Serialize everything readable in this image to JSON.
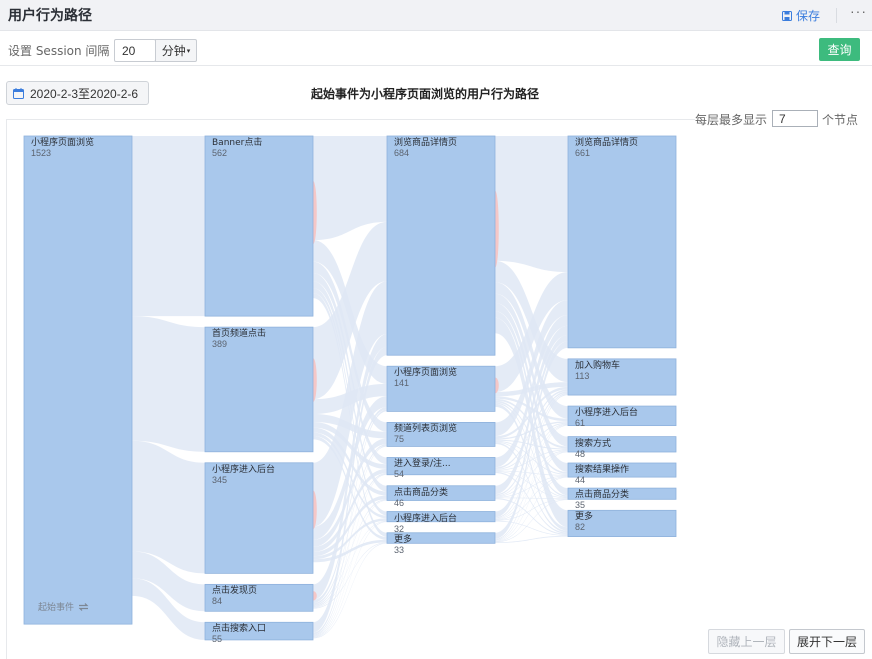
{
  "header": {
    "title": "用户行为路径",
    "save_label": "保存",
    "more_label": "···"
  },
  "settings": {
    "session_label": "设置 Session 间隔",
    "session_value": "20",
    "unit_label": "分钟",
    "query_label": "查询"
  },
  "date_range": "2020-2-3至2020-2-6",
  "chart_title": "起始事件为小程序页面浏览的用户行为路径",
  "max_nodes": {
    "prefix": "每层最多显示",
    "value": "7",
    "suffix": "个节点"
  },
  "start_tag": "起始事件",
  "buttons": {
    "prev_layer": "隐藏上一层",
    "next_layer": "展开下一层"
  },
  "colors": {
    "node": "#a9c8ec",
    "node_border": "#8fb2dc",
    "link": "#dfe8f5",
    "dropout": "#f5c7c7",
    "accent": "#3dbb7e",
    "link_text": "#3b7ddd"
  },
  "chart_data": {
    "type": "sankey",
    "layers": [
      [
        {
          "name": "小程序页面浏览",
          "value": 1523
        }
      ],
      [
        {
          "name": "Banner点击",
          "value": 562
        },
        {
          "name": "首页频道点击",
          "value": 389
        },
        {
          "name": "小程序进入后台",
          "value": 345
        },
        {
          "name": "点击发现页",
          "value": 84
        },
        {
          "name": "点击搜索入口",
          "value": 55
        }
      ],
      [
        {
          "name": "浏览商品详情页",
          "value": 684
        },
        {
          "name": "小程序页面浏览",
          "value": 141
        },
        {
          "name": "频道列表页浏览",
          "value": 75
        },
        {
          "name": "进入登录/注...",
          "value": 54
        },
        {
          "name": "点击商品分类",
          "value": 46
        },
        {
          "name": "小程序进入后台",
          "value": 32
        },
        {
          "name": "更多",
          "value": 33
        }
      ],
      [
        {
          "name": "浏览商品详情页",
          "value": 661
        },
        {
          "name": "加入购物车",
          "value": 113
        },
        {
          "name": "小程序进入后台",
          "value": 61
        },
        {
          "name": "搜索方式",
          "value": 48
        },
        {
          "name": "搜索结果操作",
          "value": 44
        },
        {
          "name": "点击商品分类",
          "value": 35
        },
        {
          "name": "更多",
          "value": 82
        }
      ]
    ]
  }
}
